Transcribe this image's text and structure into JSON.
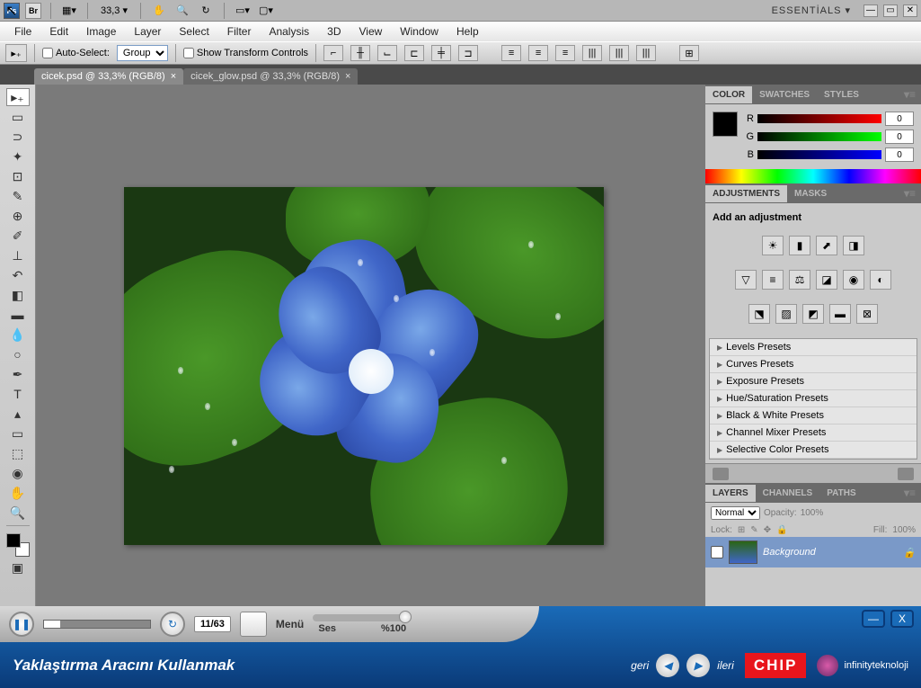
{
  "topbar": {
    "ps_label": "Ps",
    "br_label": "Br",
    "zoom": "33,3",
    "workspace": "ESSENTİALS ▾"
  },
  "menubar": [
    "File",
    "Edit",
    "Image",
    "Layer",
    "Select",
    "Filter",
    "Analysis",
    "3D",
    "View",
    "Window",
    "Help"
  ],
  "optbar": {
    "auto_select": "Auto-Select:",
    "group": "Group",
    "show_transform": "Show Transform Controls"
  },
  "tabs": [
    {
      "label": "cicek.psd @ 33,3% (RGB/8)",
      "active": true
    },
    {
      "label": "cicek_glow.psd @ 33,3% (RGB/8)",
      "active": false
    }
  ],
  "color_panel": {
    "tabs": [
      "COLOR",
      "SWATCHES",
      "STYLES"
    ],
    "channels": [
      {
        "l": "R",
        "v": "0"
      },
      {
        "l": "G",
        "v": "0"
      },
      {
        "l": "B",
        "v": "0"
      }
    ]
  },
  "adj_panel": {
    "tabs": [
      "ADJUSTMENTS",
      "MASKS"
    ],
    "label": "Add an adjustment",
    "presets": [
      "Levels Presets",
      "Curves Presets",
      "Exposure Presets",
      "Hue/Saturation Presets",
      "Black & White Presets",
      "Channel Mixer Presets",
      "Selective Color Presets"
    ]
  },
  "layers_panel": {
    "tabs": [
      "LAYERS",
      "CHANNELS",
      "PATHS"
    ],
    "blend": "Normal",
    "opacity_lbl": "Opacity:",
    "opacity": "100%",
    "lock_lbl": "Lock:",
    "fill_lbl": "Fill:",
    "fill": "100%",
    "layer_name": "Background"
  },
  "player": {
    "counter": "11/63",
    "menu": "Menü",
    "ses": "Ses",
    "vol": "%100",
    "title": "Yaklaştırma Aracını Kullanmak",
    "geri": "geri",
    "ileri": "ileri",
    "chip": "CHIP",
    "inf": "infinityteknoloji"
  }
}
